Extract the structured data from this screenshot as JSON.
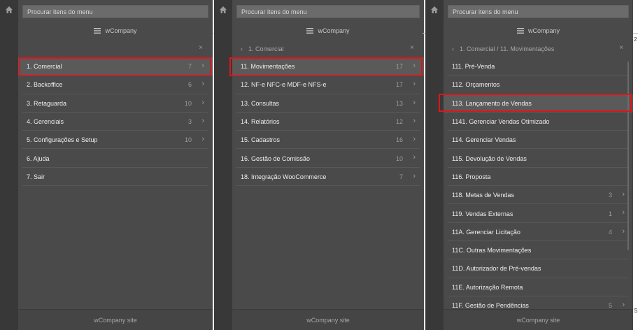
{
  "search": {
    "placeholder": "Procurar itens do menu"
  },
  "brand": {
    "name": "wCompany"
  },
  "footer": {
    "label": "wCompany site"
  },
  "panel1": {
    "items": [
      {
        "label": "1. Comercial",
        "count": "7"
      },
      {
        "label": "2. Backoffice",
        "count": "6"
      },
      {
        "label": "3. Retaguarda",
        "count": "10"
      },
      {
        "label": "4. Gerenciais",
        "count": "3"
      },
      {
        "label": "5. Configurações e Setup",
        "count": "10"
      },
      {
        "label": "6. Ajuda",
        "count": ""
      },
      {
        "label": "7. Sair",
        "count": ""
      }
    ]
  },
  "panel2": {
    "breadcrumb": "1. Comercial",
    "items": [
      {
        "label": "11. Movimentações",
        "count": "17"
      },
      {
        "label": "12. NF-e NFC-e MDF-e NFS-e",
        "count": "17"
      },
      {
        "label": "13. Consultas",
        "count": "13"
      },
      {
        "label": "14. Relatórios",
        "count": "12"
      },
      {
        "label": "15. Cadastros",
        "count": "16"
      },
      {
        "label": "16. Gestão de Comissão",
        "count": "10"
      },
      {
        "label": "18. Integração WooCommerce",
        "count": "7"
      }
    ]
  },
  "panel3": {
    "breadcrumb": "1. Comercial / 11. Movimentações",
    "items": [
      {
        "label": "111. Pré-Venda",
        "count": ""
      },
      {
        "label": "112. Orçamentos",
        "count": ""
      },
      {
        "label": "113. Lançamento de Vendas",
        "count": ""
      },
      {
        "label": "1141. Gerenciar Vendas Otimizado",
        "count": ""
      },
      {
        "label": "114. Gerenciar Vendas",
        "count": ""
      },
      {
        "label": "115. Devolução de Vendas",
        "count": ""
      },
      {
        "label": "116. Proposta",
        "count": ""
      },
      {
        "label": "118. Metas de Vendas",
        "count": "3"
      },
      {
        "label": "119. Vendas Externas",
        "count": "1"
      },
      {
        "label": "11A. Gerenciar Licitação",
        "count": "4"
      },
      {
        "label": "11C. Outras Movimentações",
        "count": ""
      },
      {
        "label": "11D. Autorizador de Pré-vendas",
        "count": ""
      },
      {
        "label": "11E. Autorização Remota",
        "count": ""
      },
      {
        "label": "11F. Gestão de Pendências",
        "count": "5"
      }
    ]
  },
  "background": {
    "edge_char_1": "2",
    "edge_char_2": "S"
  },
  "colors": {
    "panel": "#4a4a4a",
    "strip": "#383838",
    "highlight_border": "#e0141a"
  }
}
